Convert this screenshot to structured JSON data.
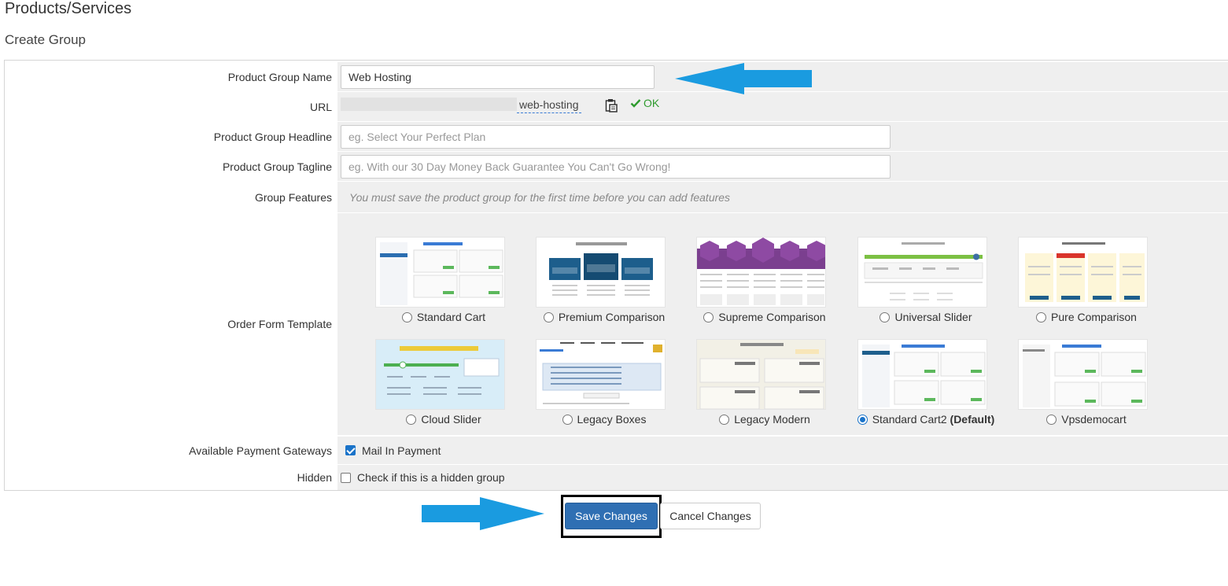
{
  "page": {
    "title": "Products/Services",
    "subtitle": "Create Group"
  },
  "form": {
    "name": {
      "label": "Product Group Name",
      "value": "Web Hosting"
    },
    "url": {
      "label": "URL",
      "slug": "web-hosting",
      "status": "OK"
    },
    "headline": {
      "label": "Product Group Headline",
      "placeholder": "eg. Select Your Perfect Plan"
    },
    "tagline": {
      "label": "Product Group Tagline",
      "placeholder": "eg. With our 30 Day Money Back Guarantee You Can't Go Wrong!"
    },
    "features": {
      "label": "Group Features",
      "note": "You must save the product group for the first time before you can add features"
    },
    "template": {
      "label": "Order Form Template",
      "options": [
        {
          "name": "Standard Cart",
          "selected": false
        },
        {
          "name": "Premium Comparison",
          "selected": false
        },
        {
          "name": "Supreme Comparison",
          "selected": false
        },
        {
          "name": "Universal Slider",
          "selected": false
        },
        {
          "name": "Pure Comparison",
          "selected": false
        },
        {
          "name": "Cloud Slider",
          "selected": false
        },
        {
          "name": "Legacy Boxes",
          "selected": false
        },
        {
          "name": "Legacy Modern",
          "selected": false
        },
        {
          "name": "Standard Cart2",
          "suffix": "(Default)",
          "selected": true
        },
        {
          "name": "Vpsdemocart",
          "selected": false
        }
      ]
    },
    "gateways": {
      "label": "Available Payment Gateways",
      "option": "Mail In Payment",
      "checked": true
    },
    "hidden": {
      "label": "Hidden",
      "option": "Check if this is a hidden group",
      "checked": false
    }
  },
  "actions": {
    "save": "Save Changes",
    "cancel": "Cancel Changes"
  },
  "colors": {
    "accent": "#2f6fb3",
    "arrow": "#1a9be0",
    "ok": "#2e9b2e"
  }
}
